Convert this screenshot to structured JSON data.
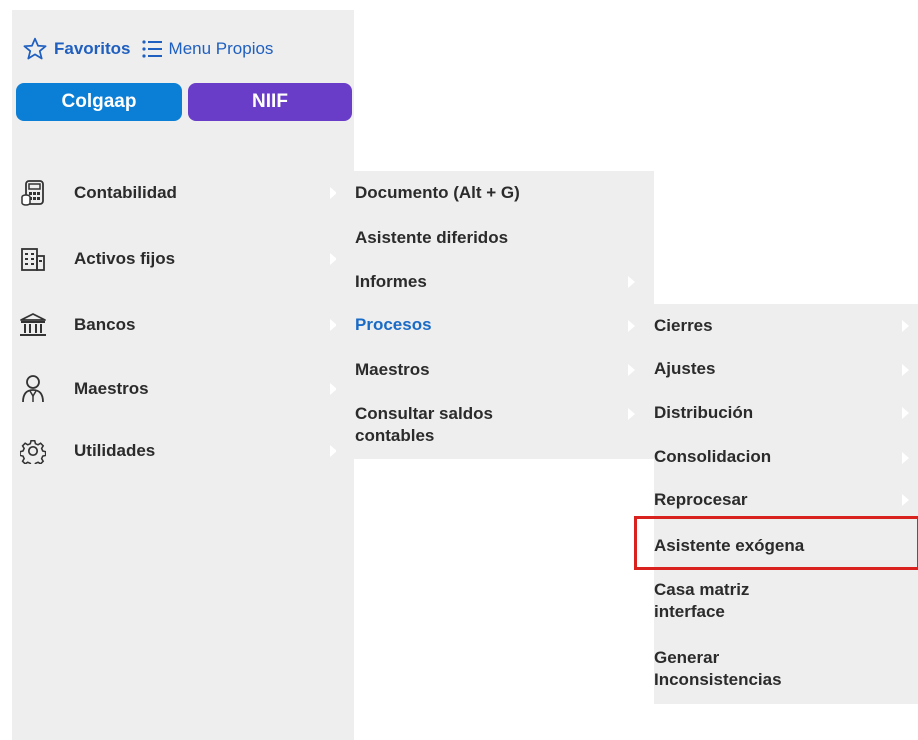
{
  "favorites_bar": {
    "favorites_label": "Favoritos",
    "menu_propios_label": "Menu Propios"
  },
  "ledgers": {
    "colgaap_label": "Colgaap",
    "niif_label": "NIIF"
  },
  "sidebar": {
    "items": [
      {
        "label": "Contabilidad",
        "icon": "calculator-icon"
      },
      {
        "label": "Activos fijos",
        "icon": "building-icon"
      },
      {
        "label": "Bancos",
        "icon": "bank-icon"
      },
      {
        "label": "Maestros",
        "icon": "user-icon"
      },
      {
        "label": "Utilidades",
        "icon": "gear-icon"
      }
    ]
  },
  "submenu_contabilidad": {
    "items": [
      {
        "label": "Documento (Alt + G)"
      },
      {
        "label": "Asistente diferidos"
      },
      {
        "label": "Informes"
      },
      {
        "label": "Procesos",
        "active": true
      },
      {
        "label": "Maestros"
      },
      {
        "label_line1": "Consultar saldos",
        "label_line2": "contables"
      }
    ]
  },
  "submenu_procesos": {
    "items": [
      {
        "label": "Cierres"
      },
      {
        "label": "Ajustes"
      },
      {
        "label": "Distribución"
      },
      {
        "label": "Consolidacion"
      },
      {
        "label": "Reprocesar"
      },
      {
        "label": "Asistente exógena",
        "highlighted": true
      },
      {
        "label_line1": "Casa matriz",
        "label_line2": "interface"
      },
      {
        "label_line1": "Generar",
        "label_line2": "Inconsistencias"
      }
    ]
  },
  "colors": {
    "favorites_blue": "#1f5fbf",
    "colgaap": "#0b7fd6",
    "niif": "#6a3dc9",
    "active_item": "#1a6bc6",
    "highlight_border": "#d9221e",
    "menu_background": "#eeeeee"
  }
}
